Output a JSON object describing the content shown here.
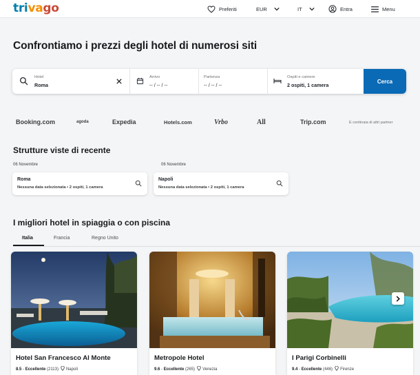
{
  "header": {
    "logo": [
      "tri",
      "va",
      "go"
    ],
    "favorites": "Preferiti",
    "currency": "EUR",
    "language": "IT",
    "login": "Entra",
    "menu": "Menu"
  },
  "hero": {
    "title": "Confrontiamo i prezzi degli hotel di numerosi siti"
  },
  "search": {
    "destination_label": "Hotel",
    "destination_value": "Roma",
    "checkin_label": "Arrivo",
    "checkin_value": "-- / -- / --",
    "checkout_label": "Partenza",
    "checkout_value": "-- / -- / --",
    "guests_label": "Ospiti e camere",
    "guests_value": "2 ospiti, 1 camera",
    "button": "Cerca"
  },
  "partners": {
    "items": [
      "Booking.com",
      "agoda",
      "Expedia",
      "Hotels.com",
      "Vrbo",
      "All",
      "Trip.com"
    ],
    "more": "E centinaia di altri partner"
  },
  "recent": {
    "title": "Strutture viste di recente",
    "items": [
      {
        "date": "06 Novembre",
        "city": "Roma",
        "details": "Nessuna data selezionata • 2 ospiti, 1 camera"
      },
      {
        "date": "06 Novembre",
        "city": "Napoli",
        "details": "Nessuna data selezionata • 2 ospiti, 1 camera"
      }
    ]
  },
  "beach": {
    "title": "I migliori hotel in spiaggia o con piscina",
    "tabs": [
      "Italia",
      "Francia",
      "Regno Unito"
    ],
    "active_tab": "Italia"
  },
  "hotels": [
    {
      "name": "Hotel San Francesco Al Monte",
      "score": "8.5",
      "rating_label": "Eccellente",
      "reviews": "(2113)",
      "city": "Napoli"
    },
    {
      "name": "Metropole Hotel",
      "score": "9.6",
      "rating_label": "Eccellente",
      "reviews": "(265)",
      "city": "Venezia"
    },
    {
      "name": "I Parigi Corbinelli",
      "score": "9.4",
      "rating_label": "Eccellente",
      "reviews": "(446)",
      "city": "Firenze"
    }
  ],
  "icons": {
    "heart": "heart-icon",
    "chevron": "chevron-down-icon",
    "user": "user-icon",
    "menu": "hamburger-icon",
    "search": "search-icon",
    "clear": "close-icon",
    "calendar": "calendar-icon",
    "bed": "bed-icon",
    "pin": "map-pin-icon",
    "next": "chevron-right-icon"
  },
  "colors": {
    "brand_blue": "#007fad",
    "brand_orange": "#f48f00",
    "brand_red": "#c94a38",
    "cta_blue": "#0a6ab6"
  }
}
